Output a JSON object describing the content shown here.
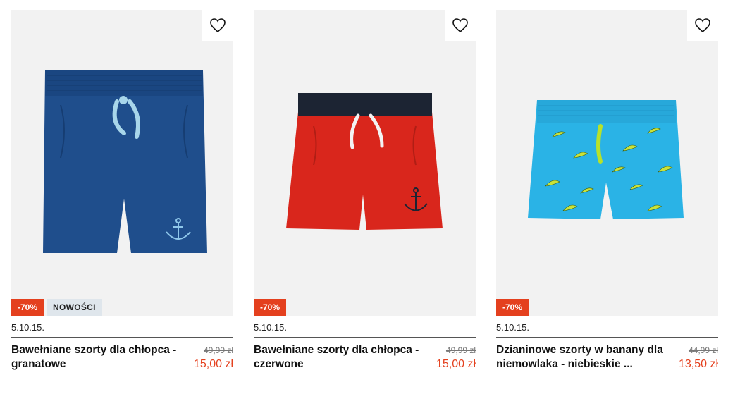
{
  "products": [
    {
      "title": "Bawełniane szorty dla chłopca - granatowe",
      "sizes": "5.10.15.",
      "old_price": "49,99 zł",
      "new_price": "15,00 zł",
      "badges": {
        "discount": "-70%",
        "new": "NOWOŚCI"
      },
      "color": "#1f4e8c"
    },
    {
      "title": "Bawełniane szorty dla chłopca - czerwone",
      "sizes": "5.10.15.",
      "old_price": "49,99 zł",
      "new_price": "15,00 zł",
      "badges": {
        "discount": "-70%"
      },
      "color": "#d9261c"
    },
    {
      "title": "Dzianinowe szorty w banany dla niemowlaka - niebieskie ...",
      "sizes": "5.10.15.",
      "old_price": "44,99 zł",
      "new_price": "13,50 zł",
      "badges": {
        "discount": "-70%"
      },
      "color": "#2ab3e6"
    }
  ],
  "icons": {
    "favorite": "heart-outline-icon"
  },
  "colors": {
    "accent": "#e4401e",
    "new_badge_bg": "#dfe6ec"
  }
}
